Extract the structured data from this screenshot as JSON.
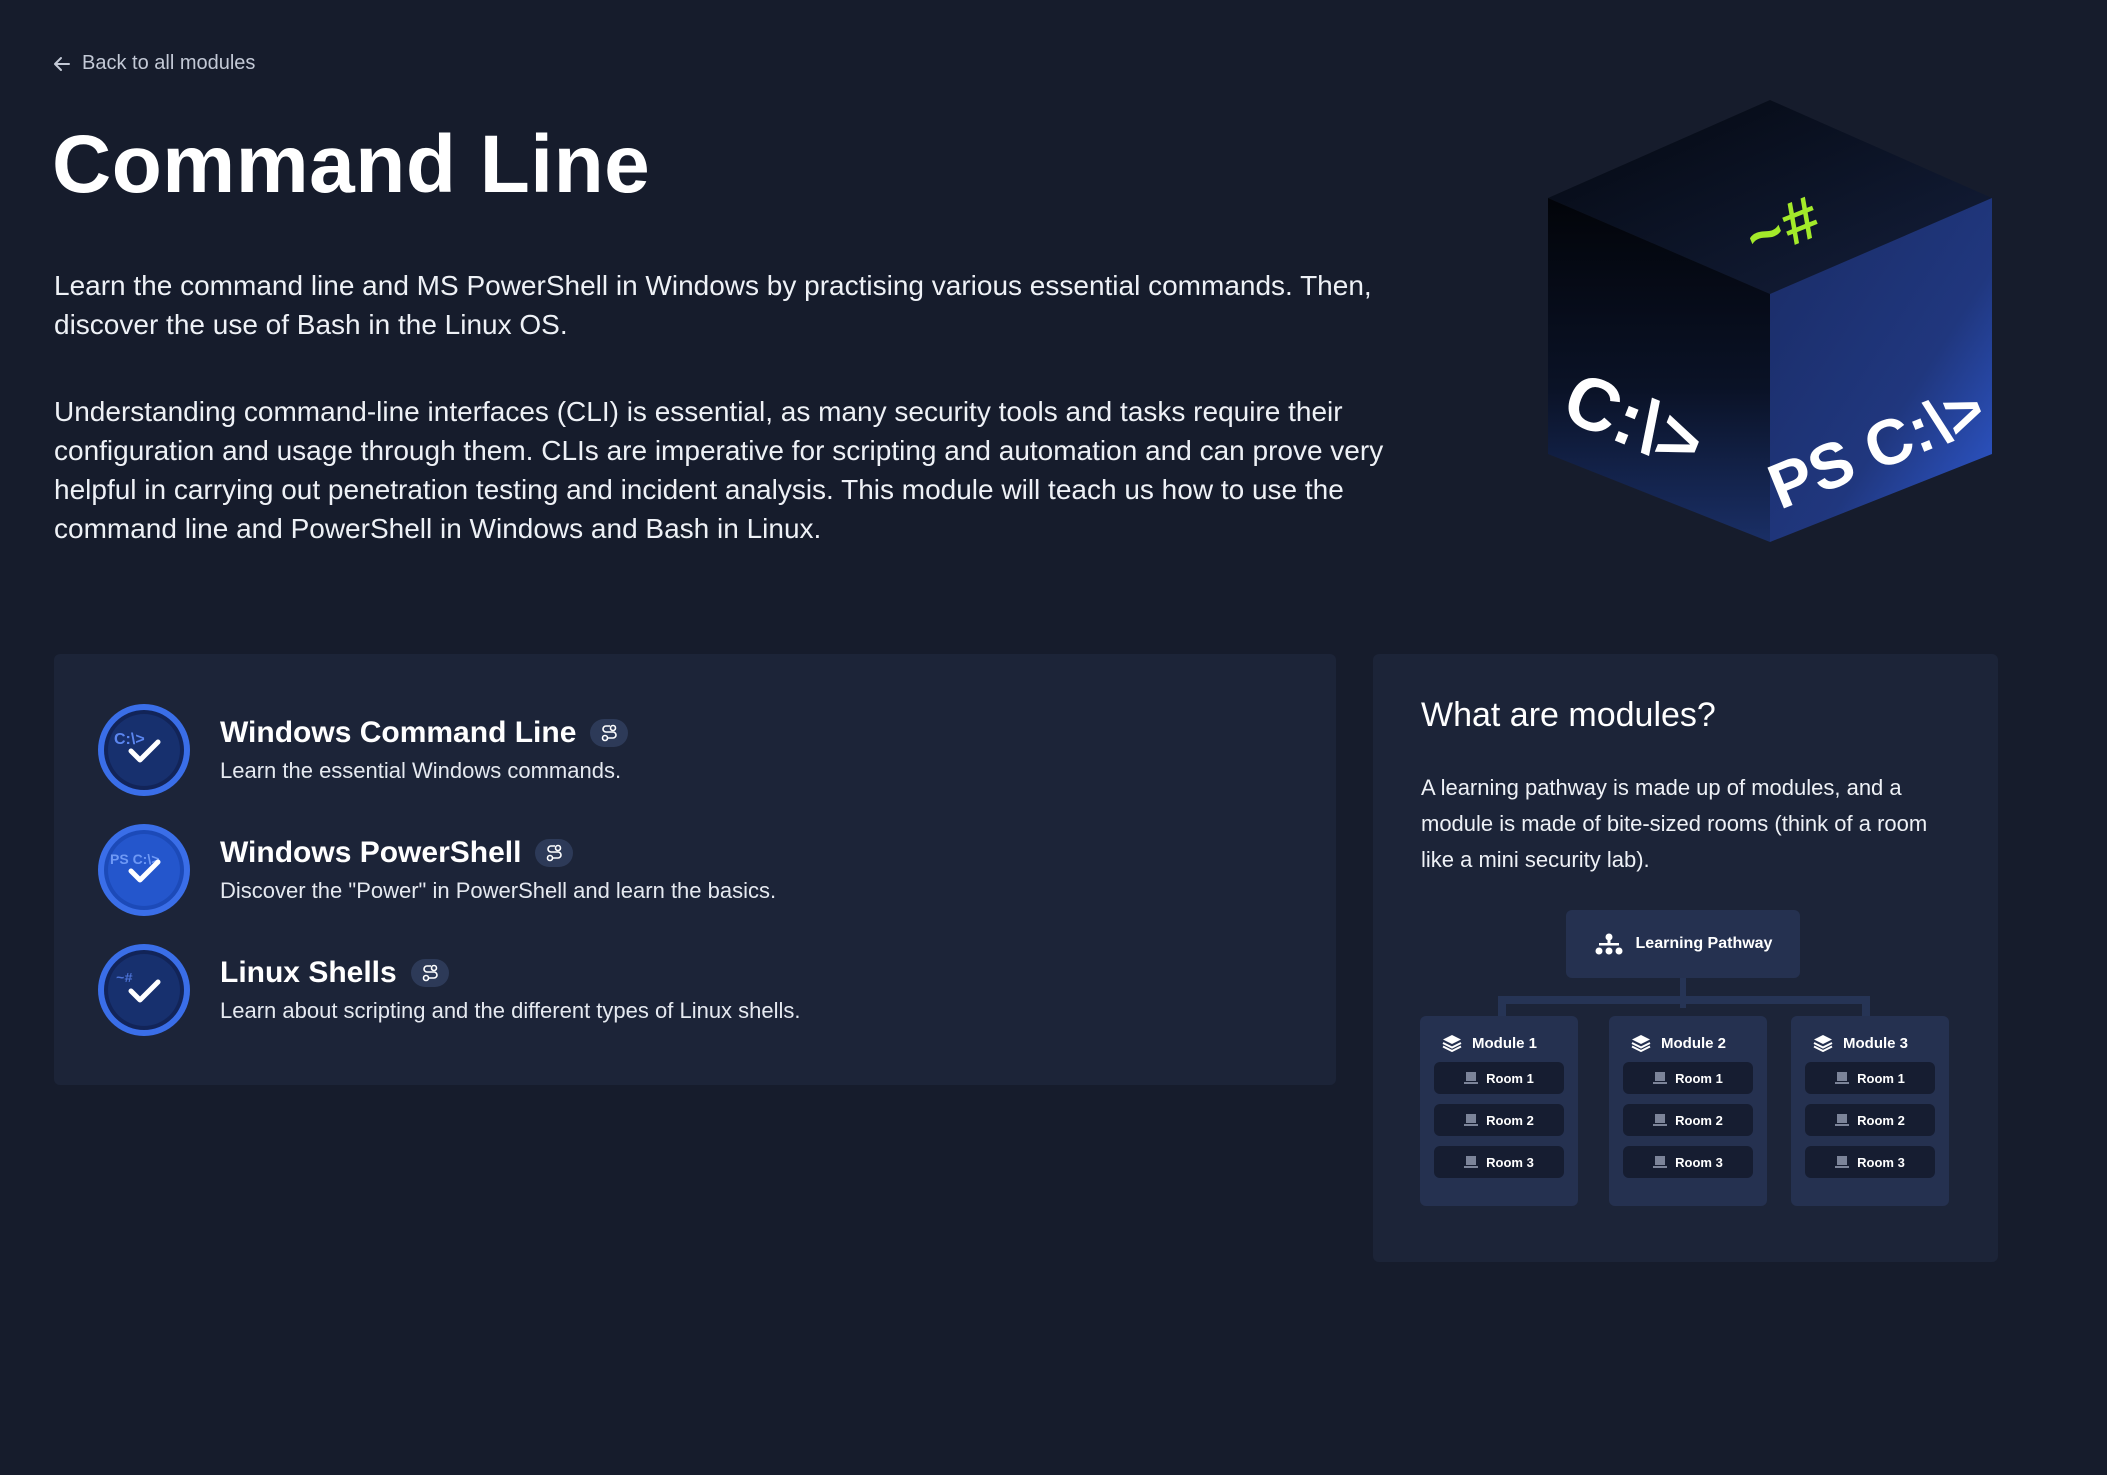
{
  "nav": {
    "back_label": "Back to all modules"
  },
  "header": {
    "title": "Command Line",
    "description_1": "Learn the command line and MS PowerShell in Windows by practising various essential commands. Then, discover the use of Bash in the Linux OS.",
    "description_2": "Understanding command-line interfaces (CLI) is essential, as many security tools and tasks require their configuration and usage through them. CLIs are imperative for scripting and automation and can prove very helpful in carrying out penetration testing and incident analysis. This module will teach us how to use the command line and PowerShell in Windows and Bash in Linux."
  },
  "hero": {
    "top_glyph": "~#",
    "left_face": "C:\\>",
    "right_face": "PS C:\\>"
  },
  "rooms": [
    {
      "title": "Windows Command Line",
      "subtitle": "Learn the essential Windows commands.",
      "badge_text": "C:\\>",
      "completed": true
    },
    {
      "title": "Windows PowerShell",
      "subtitle": "Discover the \"Power\" in PowerShell and learn the basics.",
      "badge_text": "PS C:\\>",
      "completed": true
    },
    {
      "title": "Linux Shells",
      "subtitle": "Learn about scripting and the different types of Linux shells.",
      "badge_text": "~#",
      "completed": true
    }
  ],
  "info": {
    "title": "What are modules?",
    "text": "A learning pathway is made up of modules, and a module is made of bite-sized rooms (think of a room like a mini security lab).",
    "diagram": {
      "pathway_label": "Learning Pathway",
      "modules": [
        {
          "label": "Module 1",
          "rooms": [
            "Room 1",
            "Room 2",
            "Room 3"
          ]
        },
        {
          "label": "Module 2",
          "rooms": [
            "Room 1",
            "Room 2",
            "Room 3"
          ]
        },
        {
          "label": "Module 3",
          "rooms": [
            "Room 1",
            "Room 2",
            "Room 3"
          ]
        }
      ]
    }
  },
  "colors": {
    "background": "#161c2c",
    "card": "#1c2438",
    "accent_blue": "#2f5bd6",
    "hacker_green": "#a3ea2a"
  }
}
